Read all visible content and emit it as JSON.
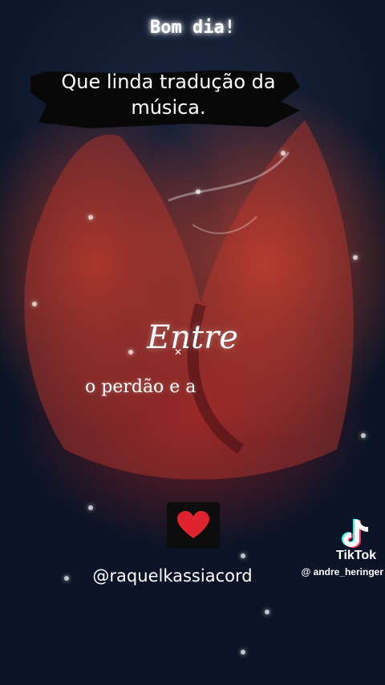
{
  "header": {
    "greeting": "Bom dia!"
  },
  "comment": {
    "line1": "Que linda tradução da",
    "line2": "música."
  },
  "lyrics": {
    "line1": "Entre",
    "line2": "o perdão e a"
  },
  "reaction": {
    "icon": "heart-icon",
    "color": "#e0242f"
  },
  "watermark": {
    "handle": "@raquelkassiacord"
  },
  "tiktok": {
    "brand": "TikTok",
    "user": "@ andre_heringer",
    "icon": "tiktok-logo-icon"
  }
}
